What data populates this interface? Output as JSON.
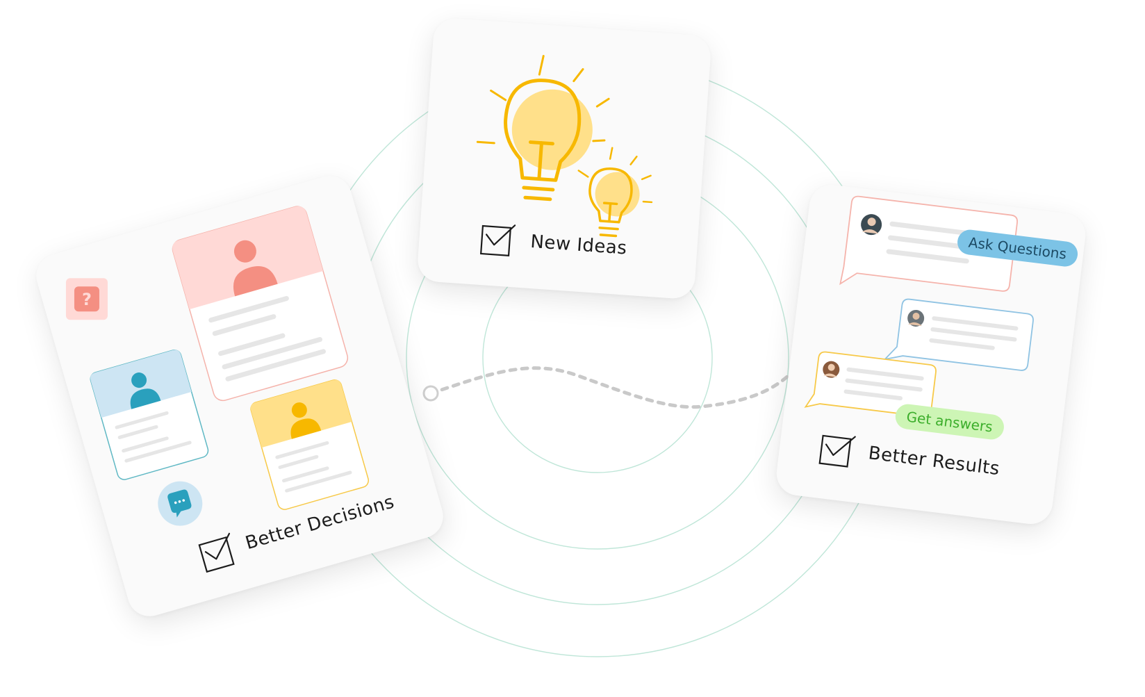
{
  "cards": {
    "decisions": {
      "label": "Better Decisions"
    },
    "ideas": {
      "label": "New Ideas"
    },
    "results": {
      "label": "Better Results"
    }
  },
  "pills": {
    "ask": "Ask Questions",
    "answers": "Get answers"
  },
  "colors": {
    "ring": "#bfe6d8",
    "pink": "#f48f82",
    "pink_light": "#ffd9d6",
    "blue": "#2aa0bd",
    "blue_light": "#cde5f3",
    "yellow": "#f7b800",
    "yellow_light": "#ffe08a",
    "green_pill": "#cdf5b5",
    "green_text": "#3cae2b",
    "ask_pill": "#7cc3e6"
  },
  "icons": [
    "question-icon",
    "chat-dots-icon",
    "person-icon",
    "lightbulb-icon",
    "checkbox-icon",
    "avatar"
  ]
}
